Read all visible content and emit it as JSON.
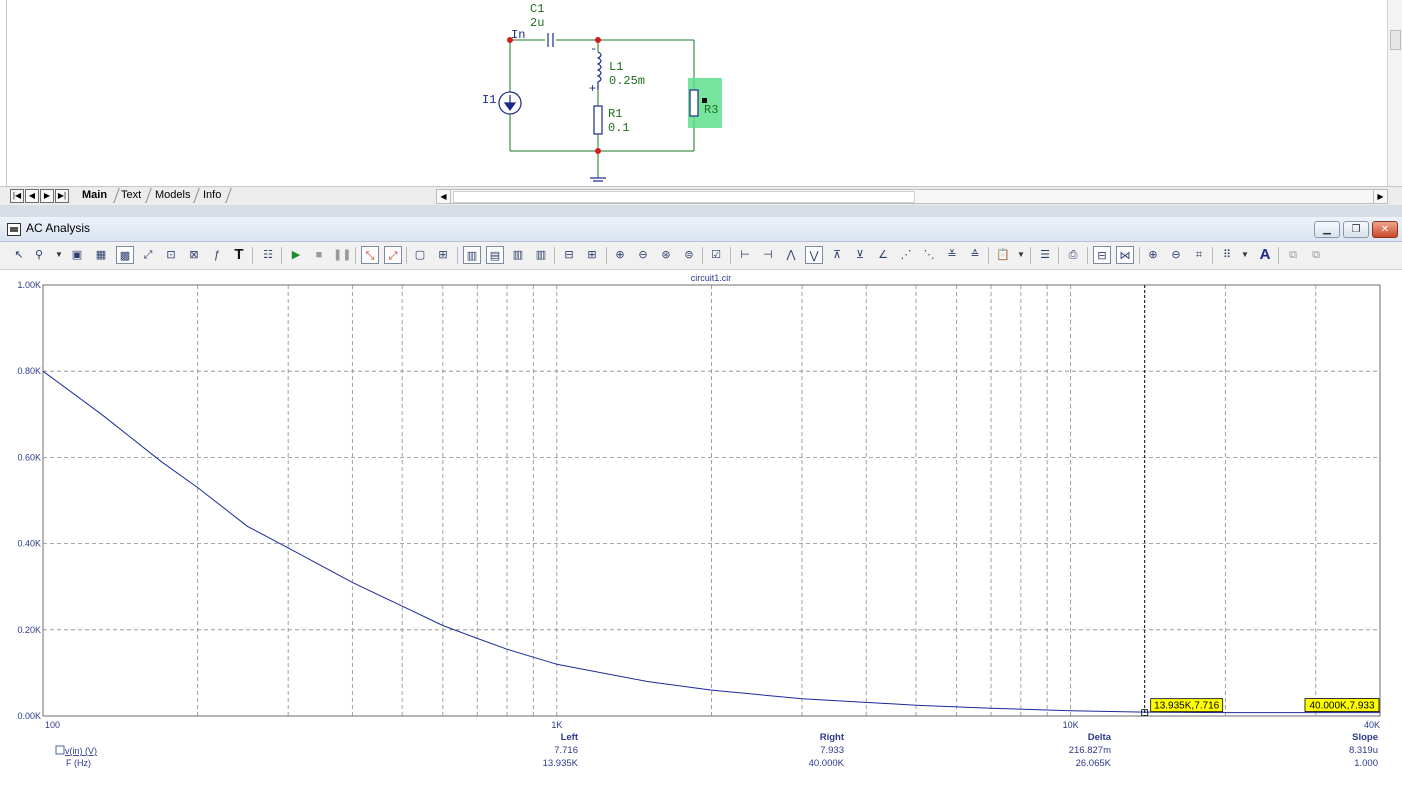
{
  "schematic": {
    "components": {
      "c1_name": "C1",
      "c1_value": "2u",
      "node_in": "In",
      "l1_name": "L1",
      "l1_value": "0.25m",
      "r1_name": "R1",
      "r1_value": "0.1",
      "i1_name": "I1",
      "r3_name": "R3"
    },
    "tabs": [
      {
        "label": "Main",
        "active": true
      },
      {
        "label": "Text",
        "active": false
      },
      {
        "label": "Models",
        "active": false
      },
      {
        "label": "Info",
        "active": false
      }
    ]
  },
  "ac_window": {
    "title": "AC Analysis",
    "controls": [
      "minimize",
      "restore",
      "close"
    ],
    "toolbar_icons": [
      "select-arrow-icon",
      "probe-icon",
      "dropdown-icon",
      "image-icon",
      "scope-icon",
      "grid-icon",
      "cursor-icon",
      "zoom-region-icon",
      "formula-icon",
      "text-T-icon",
      "properties-icon",
      "run-icon",
      "stop-icon",
      "pause-icon",
      "edit-red-icon",
      "edit-red2-icon",
      "rect-icon",
      "grid-small-icon",
      "layout-1-icon",
      "layout-2-icon",
      "layout-3-icon",
      "layout-4-icon",
      "horiz-split-icon",
      "split-4-icon",
      "zoom-in-icon",
      "zoom-out-icon",
      "zoom-fit-icon",
      "zoom-reset-icon",
      "check-icon",
      "cursor-left-icon",
      "cursor-right-icon",
      "peak-icon",
      "valley-icon",
      "high-icon",
      "low-icon",
      "inflection-icon",
      "global-high-icon",
      "global-low-icon",
      "top-icon",
      "clipboard-icon",
      "dropdown-icon",
      "list-icon",
      "data-icon",
      "table-icon",
      "align-icon",
      "magnify-plus-icon",
      "magnify-minus-icon",
      "tag-icon",
      "dots-icon",
      "dropdown-icon",
      "font-A-icon",
      "copy-icon",
      "paste-icon"
    ]
  },
  "chart_data": {
    "type": "line",
    "title": "circuit1.cir",
    "xscale": "log",
    "xlim": [
      100,
      40000
    ],
    "ylim": [
      0,
      1000
    ],
    "x_tick_labels": [
      "100",
      "1K",
      "10K",
      "40K"
    ],
    "y_tick_labels": [
      "0.00K",
      "0.20K",
      "0.40K",
      "0.60K",
      "0.80K",
      "1.00K"
    ],
    "grid": true,
    "series": [
      {
        "name": "v(in) (V)",
        "color": "#1b2a9c",
        "x": [
          100,
          130,
          170,
          200,
          250,
          300,
          400,
          500,
          600,
          700,
          800,
          1000,
          1500,
          2000,
          3000,
          5000,
          7000,
          10000,
          14000,
          20000,
          30000,
          40000
        ],
        "y": [
          800,
          700,
          590,
          530,
          440,
          390,
          310,
          255,
          210,
          180,
          155,
          120,
          80,
          60,
          40,
          25,
          18,
          12,
          9,
          8,
          8,
          8
        ]
      }
    ],
    "legend": {
      "y_expr": "v(in) (V)",
      "x_expr": "F (Hz)"
    },
    "cursor_labels": [
      {
        "text": "13.935K,7.716",
        "x": 13935,
        "y": 7.716
      },
      {
        "text": "40.000K,7.933",
        "x": 40000,
        "y": 7.933
      }
    ],
    "cursor_table": {
      "headers": [
        "Left",
        "Right",
        "Delta",
        "Slope"
      ],
      "row_y": [
        "7.716",
        "7.933",
        "216.827m",
        "8.319u"
      ],
      "row_x": [
        "13.935K",
        "40.000K",
        "26.065K",
        "1.000"
      ]
    }
  }
}
